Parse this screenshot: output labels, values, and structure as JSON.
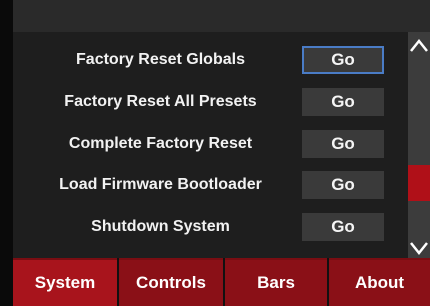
{
  "colors": {
    "panel_bg": "#1e1e1e",
    "button_bg": "#3a3a3a",
    "focus_border": "#4a7cc6",
    "tab_bg": "#8a1017",
    "tab_active_bg": "#a8141c",
    "scroll_thumb": "#b01018"
  },
  "settings": {
    "rows": [
      {
        "label": "Factory Reset Globals",
        "button": "Go"
      },
      {
        "label": "Factory Reset All Presets",
        "button": "Go"
      },
      {
        "label": "Complete Factory Reset",
        "button": "Go"
      },
      {
        "label": "Load Firmware Bootloader",
        "button": "Go"
      },
      {
        "label": "Shutdown System",
        "button": "Go"
      }
    ]
  },
  "scrollbar": {
    "up_icon": "chevron-up-icon",
    "down_icon": "chevron-down-icon"
  },
  "tabs": [
    {
      "label": "System",
      "active": true
    },
    {
      "label": "Controls",
      "active": false
    },
    {
      "label": "Bars",
      "active": false
    },
    {
      "label": "About",
      "active": false
    }
  ]
}
